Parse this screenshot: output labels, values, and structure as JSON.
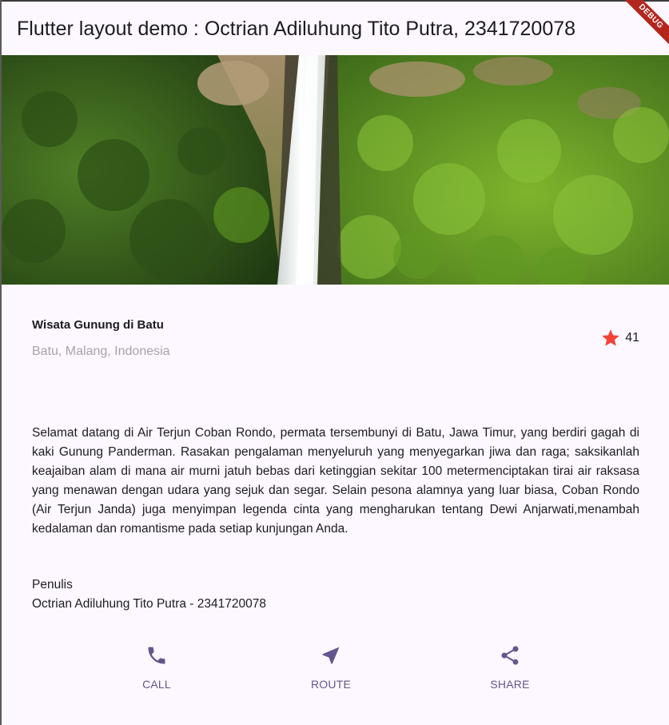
{
  "appbar": {
    "title": "Flutter layout demo : Octrian Adiluhung Tito Putra, 2341720078",
    "debug_label": "DEBUG"
  },
  "hero": {
    "image_icon": "waterfall-photo"
  },
  "place": {
    "name": "Wisata Gunung di Batu",
    "location": "Batu, Malang, Indonesia",
    "rating_count": "41",
    "rating_icon": "star-icon"
  },
  "description": "Selamat datang di Air Terjun Coban Rondo, permata tersembunyi di Batu, Jawa Timur, yang berdiri gagah di kaki Gunung Panderman. Rasakan pengalaman menyeluruh yang menyegarkan jiwa dan raga; saksikanlah keajaiban alam di mana air murni jatuh bebas dari ketinggian sekitar 100 metermenciptakan tirai air raksasa yang menawan dengan udara yang sejuk dan segar. Selain pesona alamnya yang luar biasa, Coban Rondo (Air Terjun Janda) juga menyimpan legenda cinta yang mengharukan tentang Dewi Anjarwati,menambah kedalaman dan romantisme pada setiap kunjungan Anda.",
  "author": {
    "heading": "Penulis",
    "name": "Octrian Adiluhung Tito Putra - 2341720078"
  },
  "actions": [
    {
      "label": "CALL",
      "icon": "phone-icon"
    },
    {
      "label": "ROUTE",
      "icon": "navigation-icon"
    },
    {
      "label": "SHARE",
      "icon": "share-icon"
    }
  ],
  "colors": {
    "background": "#FDF7FF",
    "accent": "#65558F",
    "star": "#F44336",
    "debug_banner": "#B3261E",
    "muted_text": "#A7A3AA"
  }
}
